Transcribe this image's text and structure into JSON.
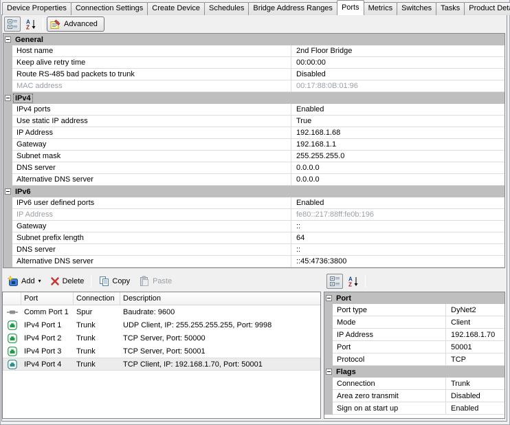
{
  "tabs": {
    "items": [
      "Device Properties",
      "Connection Settings",
      "Create Device",
      "Schedules",
      "Bridge Address Ranges",
      "Ports",
      "Metrics",
      "Switches",
      "Tasks",
      "Product Details"
    ],
    "active": "Ports"
  },
  "main_toolbar": {
    "advanced_label": "Advanced"
  },
  "bridge_properties": {
    "sections": [
      {
        "title": "General",
        "rows": [
          {
            "label": "Host name",
            "value": "2nd Floor Bridge"
          },
          {
            "label": "Keep alive retry time",
            "value": "00:00:00"
          },
          {
            "label": "Route RS-485 bad packets to trunk",
            "value": "Disabled"
          },
          {
            "label": "MAC address",
            "value": "00:17:88:0B:01:96",
            "disabled": true
          }
        ]
      },
      {
        "title": "IPv4",
        "rows": [
          {
            "label": "IPv4 ports",
            "value": "Enabled"
          },
          {
            "label": "Use static IP address",
            "value": "True"
          },
          {
            "label": "IP Address",
            "value": "192.168.1.68"
          },
          {
            "label": "Gateway",
            "value": "192.168.1.1"
          },
          {
            "label": "Subnet mask",
            "value": "255.255.255.0"
          },
          {
            "label": "DNS server",
            "value": "0.0.0.0"
          },
          {
            "label": "Alternative DNS server",
            "value": "0.0.0.0"
          }
        ]
      },
      {
        "title": "IPv6",
        "rows": [
          {
            "label": "IPv6 user defined ports",
            "value": "Enabled"
          },
          {
            "label": "IP Address",
            "value": "fe80::217:88ff:fe0b:196",
            "disabled": true
          },
          {
            "label": "Gateway",
            "value": "::"
          },
          {
            "label": "Subnet prefix length",
            "value": "64"
          },
          {
            "label": "DNS server",
            "value": "::"
          },
          {
            "label": "Alternative DNS server",
            "value": "::45:4736:3800"
          }
        ]
      }
    ]
  },
  "ports_toolbar": {
    "add_label": "Add",
    "add_caret": "▾",
    "delete_label": "Delete",
    "copy_label": "Copy",
    "paste_label": "Paste"
  },
  "ports_list": {
    "columns": [
      "Port",
      "Connection",
      "Description"
    ],
    "rows": [
      {
        "icon": "comm-port-icon",
        "icon_style": "color:#8a8f94",
        "port": "Comm Port 1",
        "connection": "Spur",
        "description": "Baudrate: 9600"
      },
      {
        "icon": "ipv4-port-icon",
        "icon_style": "color:#1f9e4a",
        "port": "IPv4 Port 1",
        "connection": "Trunk",
        "description": "UDP Client, IP: 255.255.255.255, Port: 9998"
      },
      {
        "icon": "ipv4-port-icon",
        "icon_style": "color:#1f9e4a",
        "port": "IPv4 Port 2",
        "connection": "Trunk",
        "description": "TCP Server, Port: 50000"
      },
      {
        "icon": "ipv4-port-icon",
        "icon_style": "color:#1f9e4a",
        "port": "IPv4 Port 3",
        "connection": "Trunk",
        "description": "TCP Server, Port: 50001"
      },
      {
        "icon": "ipv4-port-icon",
        "icon_style": "color:#2e8f8f",
        "port": "IPv4 Port 4",
        "connection": "Trunk",
        "description": "TCP Client, IP: 192.168.1.70, Port: 50001",
        "selected": true
      }
    ]
  },
  "port_details": {
    "sections": [
      {
        "title": "Port",
        "rows": [
          {
            "label": "Port type",
            "value": "DyNet2"
          },
          {
            "label": "Mode",
            "value": "Client"
          },
          {
            "label": "IP Address",
            "value": "192.168.1.70"
          },
          {
            "label": "Port",
            "value": "50001"
          },
          {
            "label": "Protocol",
            "value": "TCP"
          }
        ]
      },
      {
        "title": "Flags",
        "rows": [
          {
            "label": "Connection",
            "value": "Trunk"
          },
          {
            "label": "Area zero transmit",
            "value": "Disabled"
          },
          {
            "label": "Sign on at start up",
            "value": "Enabled"
          }
        ]
      }
    ]
  },
  "colors": {
    "category_bg": "#bfbfbf",
    "selection_bg": "#ececec",
    "port_icon_green": "#1f9e4a",
    "comm_icon_gray": "#8a8f94",
    "delete_red": "#c03a3a"
  }
}
